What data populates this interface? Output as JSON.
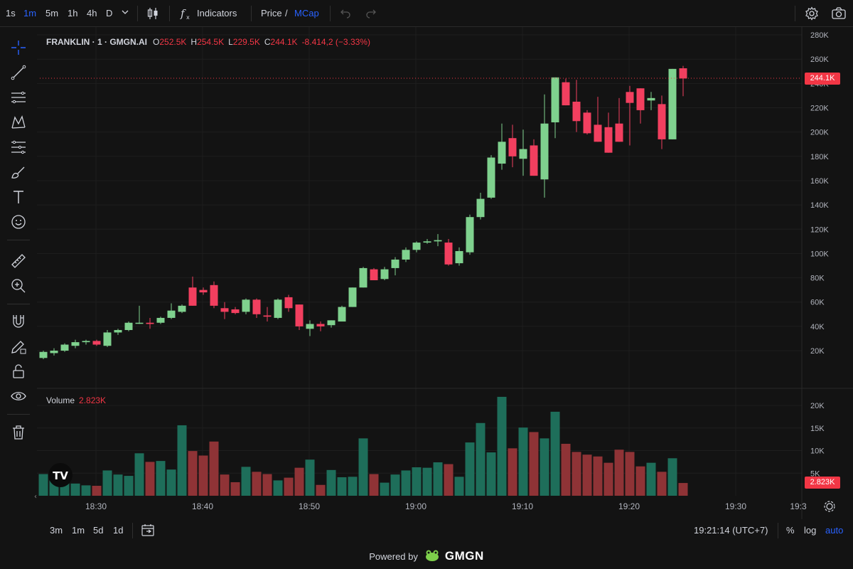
{
  "toolbar": {
    "intervals": [
      "1s",
      "1m",
      "5m",
      "1h",
      "4h",
      "D"
    ],
    "active_interval": "1m",
    "indicators_label": "Indicators",
    "price_label": "Price",
    "price_sep": "/",
    "mcap_label": "MCap"
  },
  "legend": {
    "symbol": "FRANKLIN · 1 · GMGN.AI",
    "open_label": "O",
    "open": "252.5K",
    "high_label": "H",
    "high": "254.5K",
    "low_label": "L",
    "low": "229.5K",
    "close_label": "C",
    "close": "244.1K",
    "change": "-8.414,2 (−3.33%)"
  },
  "volume_legend": {
    "label": "Volume",
    "value": "2.823K"
  },
  "price_tag": "244.1K",
  "volume_tag": "2.823K",
  "bottom": {
    "ranges": [
      "3m",
      "1m",
      "5d",
      "1d"
    ],
    "clock": "19:21:14 (UTC+7)",
    "percent": "%",
    "log": "log",
    "auto": "auto"
  },
  "footer": {
    "powered_by": "Powered by",
    "brand": "GMGN"
  },
  "colors": {
    "up": "#7fd18e",
    "down": "#f23f5f",
    "vol_up": "#1e6e5a",
    "vol_down": "#8f3336",
    "accent": "#2962ff",
    "background": "#131313"
  },
  "chart_data": {
    "type": "candlestick",
    "y_axis": {
      "ticks": [
        "280K",
        "260K",
        "240K",
        "220K",
        "200K",
        "180K",
        "160K",
        "140K",
        "120K",
        "100K",
        "80K",
        "60K",
        "40K",
        "20K"
      ],
      "range": [
        0,
        280000
      ]
    },
    "volume_axis": {
      "ticks": [
        "20K",
        "15K",
        "10K",
        "5K"
      ],
      "range": [
        0,
        22000
      ]
    },
    "x_axis": {
      "ticks": [
        "18:30",
        "18:40",
        "18:50",
        "19:00",
        "19:10",
        "19:20",
        "19:30",
        "19:3"
      ]
    },
    "candles": [
      {
        "o": 14,
        "h": 20,
        "l": 13,
        "c": 19,
        "v": 4800
      },
      {
        "o": 18,
        "h": 22,
        "l": 16,
        "c": 20,
        "v": 3400
      },
      {
        "o": 20,
        "h": 26,
        "l": 19,
        "c": 25,
        "v": 4700
      },
      {
        "o": 24,
        "h": 29,
        "l": 22,
        "c": 27,
        "v": 2700
      },
      {
        "o": 27,
        "h": 29,
        "l": 25,
        "c": 28,
        "v": 2300
      },
      {
        "o": 28,
        "h": 29,
        "l": 24,
        "c": 25,
        "v": 2200
      },
      {
        "o": 24,
        "h": 37,
        "l": 23,
        "c": 35,
        "v": 5600
      },
      {
        "o": 35,
        "h": 38,
        "l": 33,
        "c": 37,
        "v": 4700
      },
      {
        "o": 37,
        "h": 44,
        "l": 36,
        "c": 43,
        "v": 4400
      },
      {
        "o": 43,
        "h": 57,
        "l": 42,
        "c": 43,
        "v": 9400
      },
      {
        "o": 43,
        "h": 47,
        "l": 38,
        "c": 42,
        "v": 7500
      },
      {
        "o": 43,
        "h": 48,
        "l": 42,
        "c": 47,
        "v": 7700
      },
      {
        "o": 47,
        "h": 59,
        "l": 46,
        "c": 53,
        "v": 5800
      },
      {
        "o": 52,
        "h": 58,
        "l": 51,
        "c": 57,
        "v": 15600
      },
      {
        "o": 72,
        "h": 81,
        "l": 58,
        "c": 57,
        "v": 9900
      },
      {
        "o": 70,
        "h": 72,
        "l": 66,
        "c": 68,
        "v": 8900
      },
      {
        "o": 74,
        "h": 77,
        "l": 55,
        "c": 57,
        "v": 12000
      },
      {
        "o": 55,
        "h": 60,
        "l": 46,
        "c": 52,
        "v": 4700
      },
      {
        "o": 54,
        "h": 56,
        "l": 50,
        "c": 51,
        "v": 3000
      },
      {
        "o": 52,
        "h": 63,
        "l": 50,
        "c": 62,
        "v": 6400
      },
      {
        "o": 62,
        "h": 63,
        "l": 47,
        "c": 50,
        "v": 5300
      },
      {
        "o": 49,
        "h": 56,
        "l": 44,
        "c": 48,
        "v": 4800
      },
      {
        "o": 47,
        "h": 63,
        "l": 46,
        "c": 62,
        "v": 3400
      },
      {
        "o": 64,
        "h": 66,
        "l": 52,
        "c": 55,
        "v": 4000
      },
      {
        "o": 58,
        "h": 58,
        "l": 37,
        "c": 40,
        "v": 6200
      },
      {
        "o": 38,
        "h": 45,
        "l": 32,
        "c": 42,
        "v": 8000
      },
      {
        "o": 42,
        "h": 44,
        "l": 36,
        "c": 40,
        "v": 2400
      },
      {
        "o": 41,
        "h": 45,
        "l": 39,
        "c": 45,
        "v": 5700
      },
      {
        "o": 44,
        "h": 57,
        "l": 44,
        "c": 56,
        "v": 4100
      },
      {
        "o": 56,
        "h": 72,
        "l": 56,
        "c": 72,
        "v": 4200
      },
      {
        "o": 72,
        "h": 89,
        "l": 72,
        "c": 88,
        "v": 12700
      },
      {
        "o": 87,
        "h": 88,
        "l": 78,
        "c": 78,
        "v": 4800
      },
      {
        "o": 79,
        "h": 89,
        "l": 78,
        "c": 87,
        "v": 2900
      },
      {
        "o": 88,
        "h": 97,
        "l": 82,
        "c": 95,
        "v": 4700
      },
      {
        "o": 95,
        "h": 105,
        "l": 93,
        "c": 103,
        "v": 5600
      },
      {
        "o": 103,
        "h": 110,
        "l": 101,
        "c": 109,
        "v": 6300
      },
      {
        "o": 109,
        "h": 112,
        "l": 108,
        "c": 110,
        "v": 6200
      },
      {
        "o": 110,
        "h": 116,
        "l": 106,
        "c": 111,
        "v": 7400
      },
      {
        "o": 109,
        "h": 112,
        "l": 90,
        "c": 91,
        "v": 7000
      },
      {
        "o": 92,
        "h": 105,
        "l": 90,
        "c": 102,
        "v": 4200
      },
      {
        "o": 101,
        "h": 132,
        "l": 99,
        "c": 130,
        "v": 11800
      },
      {
        "o": 130,
        "h": 150,
        "l": 128,
        "c": 145,
        "v": 16100
      },
      {
        "o": 146,
        "h": 181,
        "l": 145,
        "c": 179,
        "v": 9600
      },
      {
        "o": 174,
        "h": 207,
        "l": 169,
        "c": 192,
        "v": 21900
      },
      {
        "o": 195,
        "h": 206,
        "l": 171,
        "c": 180,
        "v": 10500
      },
      {
        "o": 178,
        "h": 202,
        "l": 164,
        "c": 186,
        "v": 15100
      },
      {
        "o": 189,
        "h": 194,
        "l": 164,
        "c": 164,
        "v": 14100
      },
      {
        "o": 161,
        "h": 231,
        "l": 146,
        "c": 207,
        "v": 12700
      },
      {
        "o": 208,
        "h": 245,
        "l": 195,
        "c": 245,
        "v": 18600
      },
      {
        "o": 241,
        "h": 244,
        "l": 223,
        "c": 222,
        "v": 11500
      },
      {
        "o": 225,
        "h": 243,
        "l": 200,
        "c": 209,
        "v": 9700
      },
      {
        "o": 216,
        "h": 218,
        "l": 198,
        "c": 199,
        "v": 9100
      },
      {
        "o": 206,
        "h": 229,
        "l": 202,
        "c": 192,
        "v": 8700
      },
      {
        "o": 204,
        "h": 216,
        "l": 194,
        "c": 183,
        "v": 7300
      },
      {
        "o": 207,
        "h": 228,
        "l": 194,
        "c": 192,
        "v": 10200
      },
      {
        "o": 233,
        "h": 238,
        "l": 189,
        "c": 224,
        "v": 9700
      },
      {
        "o": 236,
        "h": 230,
        "l": 207,
        "c": 218,
        "v": 6500
      },
      {
        "o": 226,
        "h": 233,
        "l": 218,
        "c": 228,
        "v": 7300
      },
      {
        "o": 223,
        "h": 230,
        "l": 186,
        "c": 194,
        "v": 5300
      },
      {
        "o": 194,
        "h": 252,
        "l": 194,
        "c": 252,
        "v": 8300
      },
      {
        "o": 252.5,
        "h": 254.5,
        "l": 229.5,
        "c": 244.1,
        "v": 2823
      }
    ]
  }
}
